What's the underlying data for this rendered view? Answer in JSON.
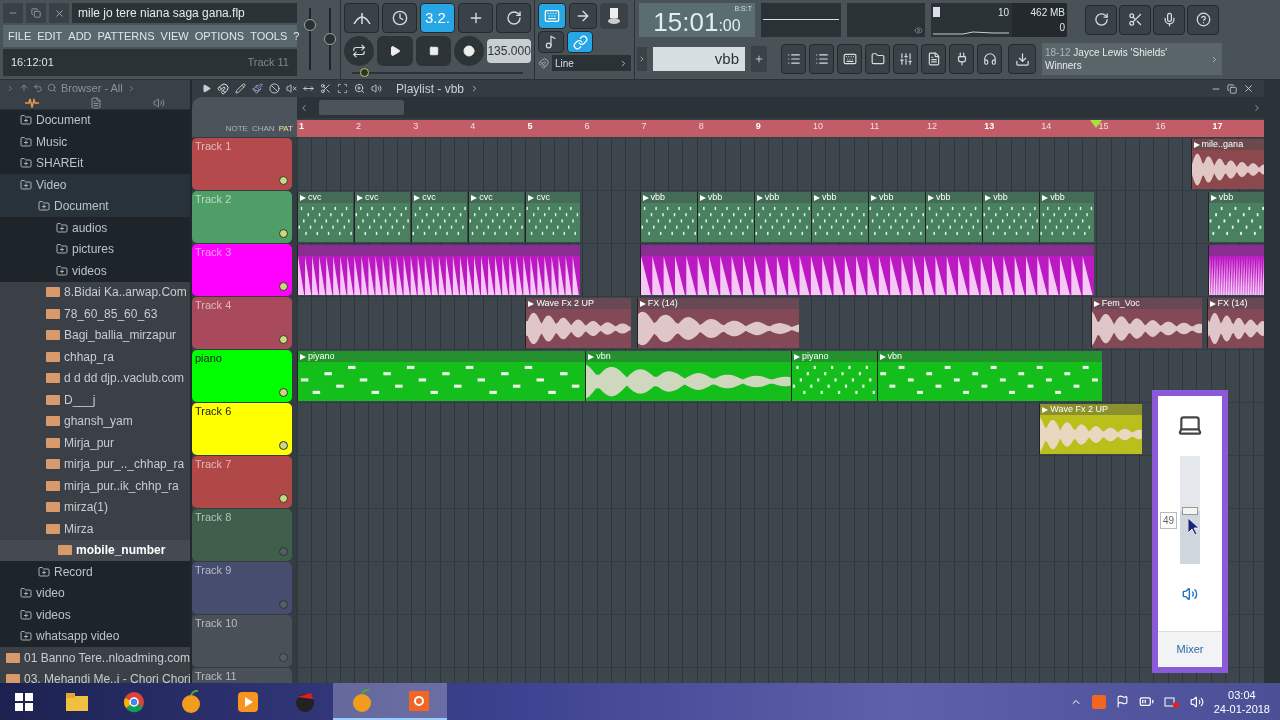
{
  "title_field": "mile jo tere niana saga gana.flp",
  "menu": [
    "FILE",
    "EDIT",
    "ADD",
    "PATTERNS",
    "VIEW",
    "OPTIONS",
    "TOOLS",
    "?"
  ],
  "hint_bar": {
    "time": "16:12:01",
    "hint": "Track 11"
  },
  "transport_toggles": [
    {
      "kind": "arc",
      "on": false
    },
    {
      "kind": "clock",
      "on": false
    },
    {
      "kind": "text",
      "label": "3.2.",
      "on": true
    },
    {
      "kind": "plus",
      "on": false
    },
    {
      "kind": "cycle",
      "on": false
    }
  ],
  "tempo": "135.000",
  "master_volume": {
    "level": 0.78
  },
  "master_pitch": {
    "level": 0.5
  },
  "song_position": {
    "level": 0.05
  },
  "view_toggles": [
    {
      "kind": "keyboard",
      "on": true
    },
    {
      "kind": "arrow",
      "on": false
    },
    {
      "kind": "note",
      "on": false
    },
    {
      "kind": "link",
      "on": true
    }
  ],
  "snap": "Line",
  "time_display": {
    "time": "15:01",
    "sub": ":00",
    "format": "B:S:T"
  },
  "cpu": {
    "cpu": "10",
    "memory": "462 MB",
    "polyphony": "0"
  },
  "pattern": "vbb",
  "news": {
    "date": "18-12",
    "title": "Jayce Lewis 'Shields'",
    "subtitle": "Winners"
  },
  "browser": {
    "title": "Browser - All",
    "tree": [
      {
        "kind": "folder",
        "label": "Document",
        "expanded": false,
        "selected": false
      },
      {
        "kind": "folder",
        "label": "Music",
        "expanded": false,
        "selected": false
      },
      {
        "kind": "folder",
        "label": "SHAREit",
        "expanded": false,
        "selected": false
      },
      {
        "kind": "folder",
        "label": "Video",
        "expanded": true,
        "selected": false,
        "children": [
          {
            "kind": "folder",
            "label": "Document",
            "expanded": true,
            "selected": false,
            "children": [
              {
                "kind": "folder",
                "label": "audios",
                "expanded": false,
                "selected": false
              },
              {
                "kind": "folder",
                "label": "pictures",
                "expanded": false,
                "selected": false
              },
              {
                "kind": "folder",
                "label": "videos",
                "expanded": false,
                "selected": false
              },
              {
                "kind": "file",
                "label": "8.Bidai Ka..arwap.Com",
                "selected": false
              },
              {
                "kind": "file",
                "label": "78_60_85_60_63",
                "selected": false
              },
              {
                "kind": "file",
                "label": "Bagi_ballia_mirzapur",
                "selected": false
              },
              {
                "kind": "file",
                "label": "chhap_ra",
                "selected": false
              },
              {
                "kind": "file",
                "label": "d d dd djp..vaclub.com",
                "selected": false
              },
              {
                "kind": "file",
                "label": "D___j",
                "selected": false
              },
              {
                "kind": "file",
                "label": "ghansh_yam",
                "selected": false
              },
              {
                "kind": "file",
                "label": "Mirja_pur",
                "selected": false
              },
              {
                "kind": "file",
                "label": "mirja_pur_.._chhap_ra",
                "selected": false
              },
              {
                "kind": "file",
                "label": "mirja_pur..ik_chhp_ra",
                "selected": false
              },
              {
                "kind": "file",
                "label": "mirza(1)",
                "selected": false
              },
              {
                "kind": "file",
                "label": "Mirza",
                "selected": false
              },
              {
                "kind": "file",
                "label": "mobile_number",
                "selected": true
              }
            ]
          },
          {
            "kind": "folder",
            "label": "Record",
            "expanded": false,
            "selected": false
          }
        ]
      },
      {
        "kind": "folder",
        "label": "video",
        "expanded": false,
        "selected": false
      },
      {
        "kind": "folder",
        "label": "videos",
        "expanded": false,
        "selected": false
      },
      {
        "kind": "folder",
        "label": "whatsapp video",
        "expanded": false,
        "selected": false
      },
      {
        "kind": "file",
        "label": "01 Banno Tere..nloadming.com",
        "selected": false
      },
      {
        "kind": "file",
        "label": "03. Mehandi Me..i - Chori Chori",
        "selected": false
      }
    ]
  },
  "playlist": {
    "title": "Playlist - vbb",
    "source_labels": [
      "NOTE",
      "CHAN",
      "PAT"
    ],
    "ruler": [
      "1",
      "2",
      "3",
      "4",
      "5",
      "6",
      "7",
      "8",
      "9",
      "10",
      "11",
      "12",
      "13",
      "14",
      "15",
      "16",
      "17"
    ],
    "tracks": [
      {
        "name": "Track 1",
        "color": "#b54a4d",
        "enabled": true,
        "clips": [
          {
            "kind": "audio",
            "label": "mile..gana"
          }
        ]
      },
      {
        "name": "Track 2",
        "color": "#4f9e68",
        "enabled": true,
        "clips": [
          {
            "kind": "pattern",
            "label": "cvc"
          },
          {
            "kind": "pattern",
            "label": "cvc"
          },
          {
            "kind": "pattern",
            "label": "cvc"
          },
          {
            "kind": "pattern",
            "label": "cvc"
          },
          {
            "kind": "pattern",
            "label": "cvc"
          },
          {
            "kind": "pattern",
            "label": "vbb"
          },
          {
            "kind": "pattern",
            "label": "vbb"
          },
          {
            "kind": "pattern",
            "label": "vbb"
          },
          {
            "kind": "pattern",
            "label": "vbb"
          },
          {
            "kind": "pattern",
            "label": "vbb"
          },
          {
            "kind": "pattern",
            "label": "vbb"
          },
          {
            "kind": "pattern",
            "label": "vbb"
          },
          {
            "kind": "pattern",
            "label": "vbb"
          },
          {
            "kind": "pattern",
            "label": "vbb"
          }
        ]
      },
      {
        "name": "Track 3",
        "color": "#ff00ff",
        "enabled": true,
        "clips": [
          {
            "kind": "strip"
          },
          {
            "kind": "strip"
          },
          {
            "kind": "strip"
          }
        ]
      },
      {
        "name": "Track 4",
        "color": "#a84a5c",
        "enabled": true,
        "clips": [
          {
            "kind": "audio",
            "label": "Wave Fx 2 UP"
          },
          {
            "kind": "audio",
            "label": "FX (14)"
          },
          {
            "kind": "audio",
            "label": "Fem_Voc"
          },
          {
            "kind": "audio",
            "label": "FX (14)"
          }
        ]
      },
      {
        "name": "piano",
        "color": "#00ff00",
        "enabled": true,
        "clips": [
          {
            "kind": "pattern",
            "label": "piyano"
          },
          {
            "kind": "audio",
            "label": "vbn"
          },
          {
            "kind": "pattern",
            "label": "piyano"
          },
          {
            "kind": "pattern",
            "label": "vbn"
          }
        ]
      },
      {
        "name": "Track 6",
        "color": "#ffff00",
        "enabled": true,
        "clips": [
          {
            "kind": "audio",
            "label": "Wave Fx 2 UP"
          }
        ]
      },
      {
        "name": "Track 7",
        "color": "#b04848",
        "enabled": true
      },
      {
        "name": "Track 8",
        "color": "#3f5e4b",
        "enabled": false
      },
      {
        "name": "Track 9",
        "color": "#464d6e",
        "enabled": false
      },
      {
        "name": "Track 10",
        "color": "#4a5058",
        "enabled": false
      },
      {
        "name": "Track 11",
        "color": "#4a5058"
      }
    ]
  },
  "volume_popup": {
    "level": 0.49,
    "reading": "49",
    "link": "Mixer"
  },
  "taskbar": {
    "apps": [
      {
        "kind": "explorer",
        "active": false
      },
      {
        "kind": "browser",
        "active": false
      },
      {
        "kind": "studio",
        "active": false
      },
      {
        "kind": "player",
        "active": false
      },
      {
        "kind": "red-app",
        "active": false
      },
      {
        "kind": "studio",
        "active": true
      },
      {
        "kind": "recorder",
        "active": true
      }
    ],
    "time": "03:04",
    "date": "24-01-2018"
  }
}
